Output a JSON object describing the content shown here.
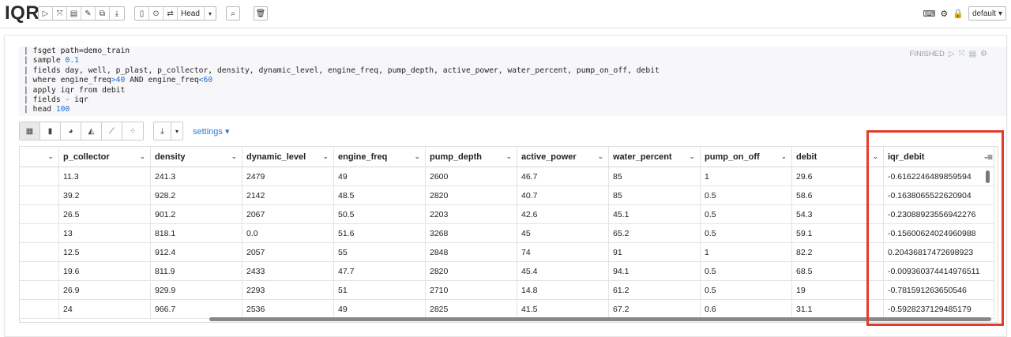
{
  "app": {
    "title": "IQR"
  },
  "toolbar": {
    "head_label": "Head",
    "default_label": "default"
  },
  "paragraph": {
    "status": "FINISHED",
    "settings_label": "settings"
  },
  "code": {
    "line1_pre": "| fsget path=demo_train",
    "line2_pre": "| sample ",
    "line2_num": "0.1",
    "line3_pre": "| fields day, well, p_plast, p_collector, density, dynamic_level, engine_freq, pump_depth, active_power, water_percent, pump_on_off, debit",
    "line4_pre": "| where engine_freq",
    "line4_op1": ">40",
    "line4_mid": " AND engine_freq",
    "line4_op2": "<60",
    "line5_pre": "| apply iqr from debit",
    "line6_pre": "| fields ",
    "line6_op": "-",
    "line6_post": " iqr",
    "line7_pre": "| head ",
    "line7_num": "100"
  },
  "table": {
    "columns": [
      "",
      "p_collector",
      "density",
      "dynamic_level",
      "engine_freq",
      "pump_depth",
      "active_power",
      "water_percent",
      "pump_on_off",
      "debit",
      "iqr_debit"
    ],
    "rows": [
      [
        "",
        "11.3",
        "241.3",
        "2479",
        "49",
        "2600",
        "46.7",
        "85",
        "1",
        "29.6",
        "-0.6162246489859594"
      ],
      [
        "",
        "39.2",
        "928.2",
        "2142",
        "48.5",
        "2820",
        "40.7",
        "85",
        "0.5",
        "58.6",
        "-0.1638065522620904"
      ],
      [
        "",
        "26.5",
        "901.2",
        "2067",
        "50.5",
        "2203",
        "42.6",
        "45.1",
        "0.5",
        "54.3",
        "-0.23088923556942276"
      ],
      [
        "",
        "13",
        "818.1",
        "0.0",
        "51.6",
        "3268",
        "45",
        "65.2",
        "0.5",
        "59.1",
        "-0.15600624024960988"
      ],
      [
        "",
        "12.5",
        "912.4",
        "2057",
        "55",
        "2848",
        "74",
        "91",
        "1",
        "82.2",
        "0.20436817472698923"
      ],
      [
        "",
        "19.6",
        "811.9",
        "2433",
        "47.7",
        "2820",
        "45.4",
        "94.1",
        "0.5",
        "68.5",
        "-0.009360374414976511"
      ],
      [
        "",
        "26.9",
        "929.9",
        "2293",
        "51",
        "2710",
        "14.8",
        "61.2",
        "0.5",
        "19",
        "-0.781591263650546"
      ],
      [
        "",
        "24",
        "966.7",
        "2536",
        "49",
        "2825",
        "41.5",
        "67.2",
        "0.6",
        "31.1",
        "-0.5928237129485179"
      ]
    ]
  },
  "colors": {
    "highlight": "#e53b2c",
    "link": "#2b7bd6",
    "keyword": "#1c6bd8"
  }
}
